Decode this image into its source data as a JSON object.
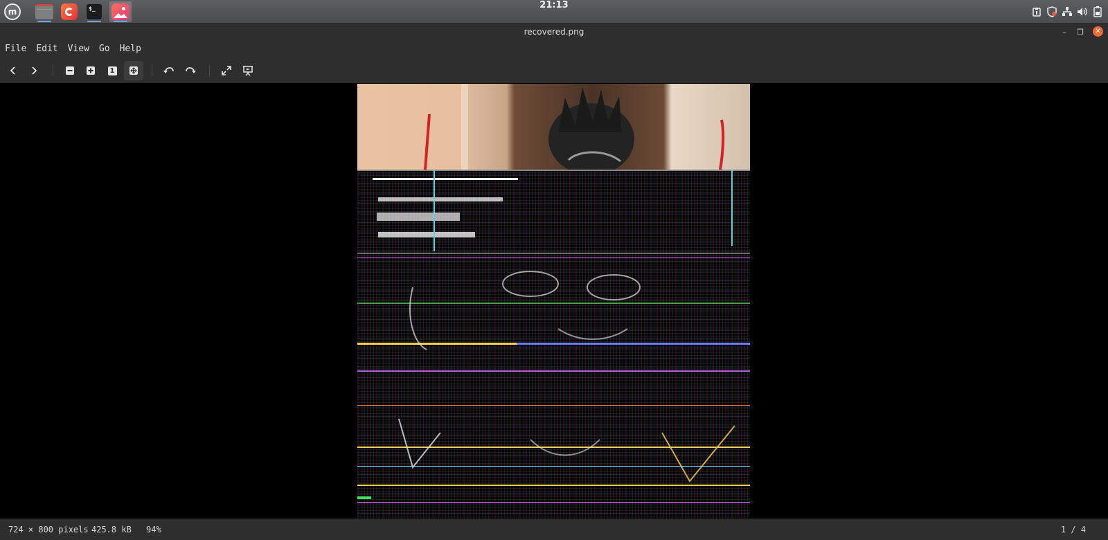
{
  "taskbar": {
    "menu_icon": "linux-mint-logo-icon",
    "apps": [
      {
        "name": "files-app-icon",
        "active": false
      },
      {
        "name": "firefox-app-icon",
        "active": false
      },
      {
        "name": "terminal-app-icon",
        "active": false
      },
      {
        "name": "image-viewer-app-icon",
        "active": true
      }
    ],
    "terminal_glyph": "$_",
    "clock": "21:13",
    "tray_icons": [
      "clipboard-icon",
      "shield-icon",
      "network-icon",
      "volume-icon",
      "battery-icon"
    ]
  },
  "window": {
    "title": "recovered.png",
    "minimize_glyph": "–",
    "maximize_glyph": "❐",
    "close_glyph": "✕"
  },
  "menubar": {
    "items": [
      "File",
      "Edit",
      "View",
      "Go",
      "Help"
    ]
  },
  "toolbar": {
    "buttons": [
      "back-icon",
      "forward-icon",
      "zoom-out-icon",
      "zoom-in-icon",
      "zoom-normal-icon",
      "zoom-fit-icon",
      "rotate-left-icon",
      "rotate-right-icon",
      "fullscreen-icon",
      "slideshow-icon"
    ],
    "zoom_normal_glyph": "1"
  },
  "statusbar": {
    "dimensions": "724 × 800 pixels",
    "file_size": "425.8 kB",
    "zoom": "94%",
    "position": "1 / 4"
  },
  "colors": {
    "taskbar": "#4f5255",
    "chrome": "#2e2e2e",
    "close_button": "#f06a35",
    "viewer_background": "#000000"
  }
}
